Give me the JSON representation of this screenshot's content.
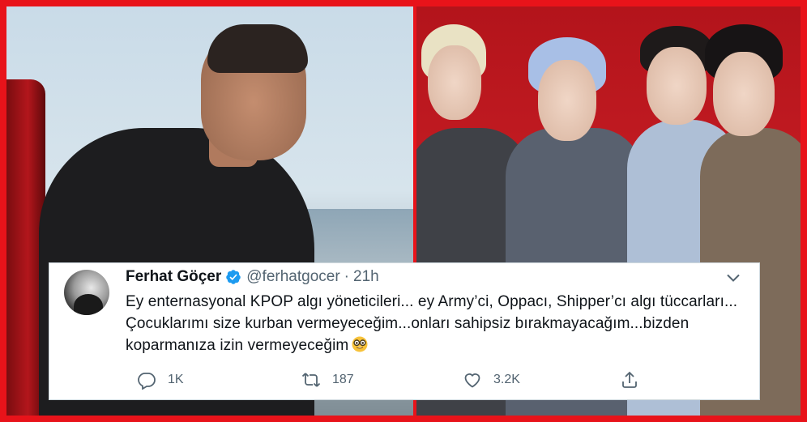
{
  "tweet": {
    "author_name": "Ferhat Göçer",
    "handle": "@ferhatgocer",
    "separator": "·",
    "time": "21h",
    "text": "Ey enternasyonal KPOP algı yöneticileri... ey Army’ci, Oppacı, Shipper’cı algı tüccarları... Çocuklarımı size kurban vermeyeceğim...onları sahipsiz bırakmayacağım...bizden koparmanıza izin vermeyeceğim",
    "emoji_icon": "nerd-face-emoji",
    "replies": "1K",
    "retweets": "187",
    "likes": "3.2K"
  },
  "colors": {
    "frame_red": "#e8131a",
    "twitter_blue": "#1d9bf0",
    "muted_gray": "#536471"
  }
}
